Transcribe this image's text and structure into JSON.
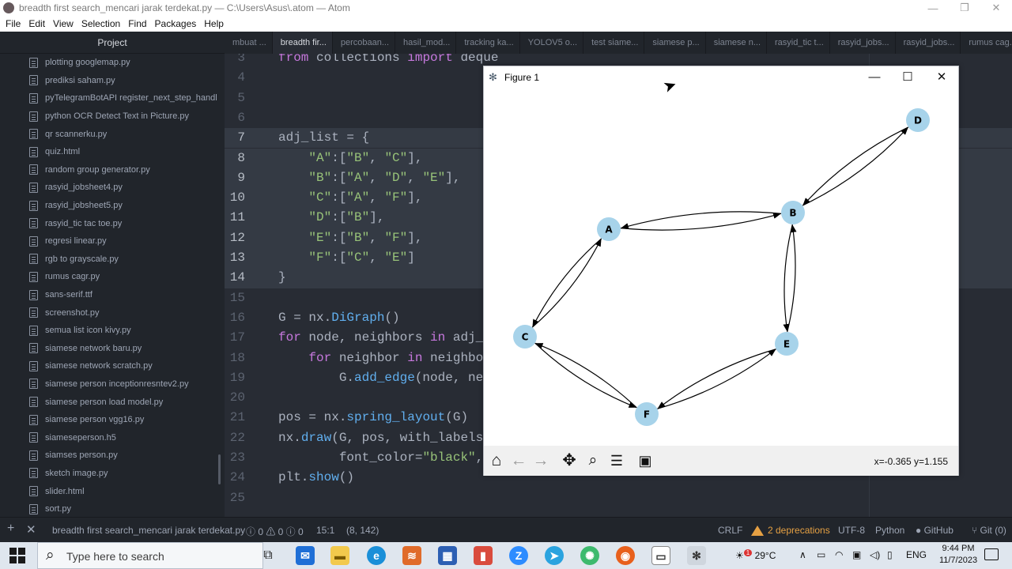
{
  "window": {
    "title": "breadth first search_mencari jarak terdekat.py — C:\\Users\\Asus\\.atom — Atom",
    "minimize": "—",
    "maximize": "❐",
    "close": "✕"
  },
  "menu": [
    "File",
    "Edit",
    "View",
    "Selection",
    "Find",
    "Packages",
    "Help"
  ],
  "sidebar": {
    "title": "Project",
    "files": [
      "plotting googlemap.py",
      "prediksi saham.py",
      "pyTelegramBotAPI register_next_step_handl",
      "python OCR Detect Text in Picture.py",
      "qr scannerku.py",
      "quiz.html",
      "random group generator.py",
      "rasyid_jobsheet4.py",
      "rasyid_jobsheet5.py",
      "rasyid_tic tac toe.py",
      "regresi linear.py",
      "rgb to grayscale.py",
      "rumus cagr.py",
      "sans-serif.ttf",
      "screenshot.py",
      "semua list icon kivy.py",
      "siamese network baru.py",
      "siamese network scratch.py",
      "siamese person inceptionresntev2.py",
      "siamese person load model.py",
      "siamese person vgg16.py",
      "siameseperson.h5",
      "siamses person.py",
      "sketch image.py",
      "slider.html",
      "sort.py"
    ]
  },
  "tabs": [
    {
      "label": "mbuat ...",
      "active": false
    },
    {
      "label": "breadth fir...",
      "active": true
    },
    {
      "label": "percobaan...",
      "active": false
    },
    {
      "label": "hasil_mod...",
      "active": false
    },
    {
      "label": "tracking ka...",
      "active": false
    },
    {
      "label": "YOLOV5 o...",
      "active": false
    },
    {
      "label": "test siame...",
      "active": false
    },
    {
      "label": "siamese p...",
      "active": false
    },
    {
      "label": "siamese n...",
      "active": false
    },
    {
      "label": "rasyid_tic t...",
      "active": false
    },
    {
      "label": "rasyid_jobs...",
      "active": false
    },
    {
      "label": "rasyid_jobs...",
      "active": false
    },
    {
      "label": "rumus cag...",
      "active": false
    }
  ],
  "editor": {
    "lines": [
      {
        "num": "3",
        "html": "<span class=\"kw\">from</span> collections <span class=\"kw\">import</span> deque"
      },
      {
        "num": "4",
        "html": ""
      },
      {
        "num": "5",
        "html": ""
      },
      {
        "num": "6",
        "html": ""
      },
      {
        "num": "7",
        "html": "adj_list = {",
        "current": true
      },
      {
        "num": "8",
        "html": "    <span class=\"str\">\"A\"</span>:[<span class=\"str\">\"B\"</span>, <span class=\"str\">\"C\"</span>],",
        "current": true
      },
      {
        "num": "9",
        "html": "    <span class=\"str\">\"B\"</span>:[<span class=\"str\">\"A\"</span>, <span class=\"str\">\"D\"</span>, <span class=\"str\">\"E\"</span>],",
        "current": true
      },
      {
        "num": "10",
        "html": "    <span class=\"str\">\"C\"</span>:[<span class=\"str\">\"A\"</span>, <span class=\"str\">\"F\"</span>],",
        "current": true
      },
      {
        "num": "11",
        "html": "    <span class=\"str\">\"D\"</span>:[<span class=\"str\">\"B\"</span>],",
        "current": true
      },
      {
        "num": "12",
        "html": "    <span class=\"str\">\"E\"</span>:[<span class=\"str\">\"B\"</span>, <span class=\"str\">\"F\"</span>],",
        "current": true
      },
      {
        "num": "13",
        "html": "    <span class=\"str\">\"F\"</span>:[<span class=\"str\">\"C\"</span>, <span class=\"str\">\"E\"</span>]",
        "current": true
      },
      {
        "num": "14",
        "html": "}",
        "current": true
      },
      {
        "num": "15",
        "html": ""
      },
      {
        "num": "16",
        "html": "G = nx.<span class=\"fn\">DiGraph</span>()"
      },
      {
        "num": "17",
        "html": "<span class=\"kw\">for</span> node, neighbors <span class=\"kw\">in</span> adj_l"
      },
      {
        "num": "18",
        "html": "    <span class=\"kw\">for</span> neighbor <span class=\"kw\">in</span> neighbor"
      },
      {
        "num": "19",
        "html": "        G.<span class=\"fn\">add_edge</span>(node, nei"
      },
      {
        "num": "20",
        "html": ""
      },
      {
        "num": "21",
        "html": "pos = nx.<span class=\"fn\">spring_layout</span>(G)"
      },
      {
        "num": "22",
        "html": "nx.<span class=\"fn\">draw</span>(G, pos, with_labels="
      },
      {
        "num": "23",
        "html": "        font_color=<span class=\"str\">\"black\"</span>,"
      },
      {
        "num": "24",
        "html": "plt.<span class=\"fn\">show</span>()"
      },
      {
        "num": "25",
        "html": ""
      }
    ]
  },
  "figure": {
    "title": "Figure 1",
    "minimize": "—",
    "maximize": "☐",
    "close": "✕",
    "coords": "x=-0.365 y=1.155",
    "toolbar": [
      "home-icon",
      "back-arrow-icon",
      "forward-arrow-icon",
      "pan-icon",
      "zoom-icon",
      "configure-subplots-icon",
      "save-icon"
    ],
    "node_color": "#a7d3ea"
  },
  "graph": {
    "nodes": [
      "A",
      "B",
      "C",
      "D",
      "E",
      "F"
    ],
    "edges": [
      [
        "A",
        "B"
      ],
      [
        "A",
        "C"
      ],
      [
        "B",
        "A"
      ],
      [
        "B",
        "D"
      ],
      [
        "B",
        "E"
      ],
      [
        "C",
        "A"
      ],
      [
        "C",
        "F"
      ],
      [
        "D",
        "B"
      ],
      [
        "E",
        "B"
      ],
      [
        "E",
        "F"
      ],
      [
        "F",
        "C"
      ],
      [
        "F",
        "E"
      ]
    ]
  },
  "statusbar": {
    "file": "breadth first search_mencari jarak terdekat.py",
    "diagnostics": "ⓘ 0 ⚠ 0 ⓘ 0",
    "cursor": "15:1",
    "selection": "(8, 142)",
    "line_ending": "CRLF",
    "deprecations": "2 deprecations",
    "encoding": "UTF-8",
    "grammar": "Python",
    "github": "GitHub",
    "git": "Git (0)"
  },
  "taskbar": {
    "search_placeholder": "Type here to search",
    "weather": "29°C",
    "language": "ENG",
    "time": "9:44 PM",
    "date": "11/7/2023",
    "weather_badge": "1"
  }
}
